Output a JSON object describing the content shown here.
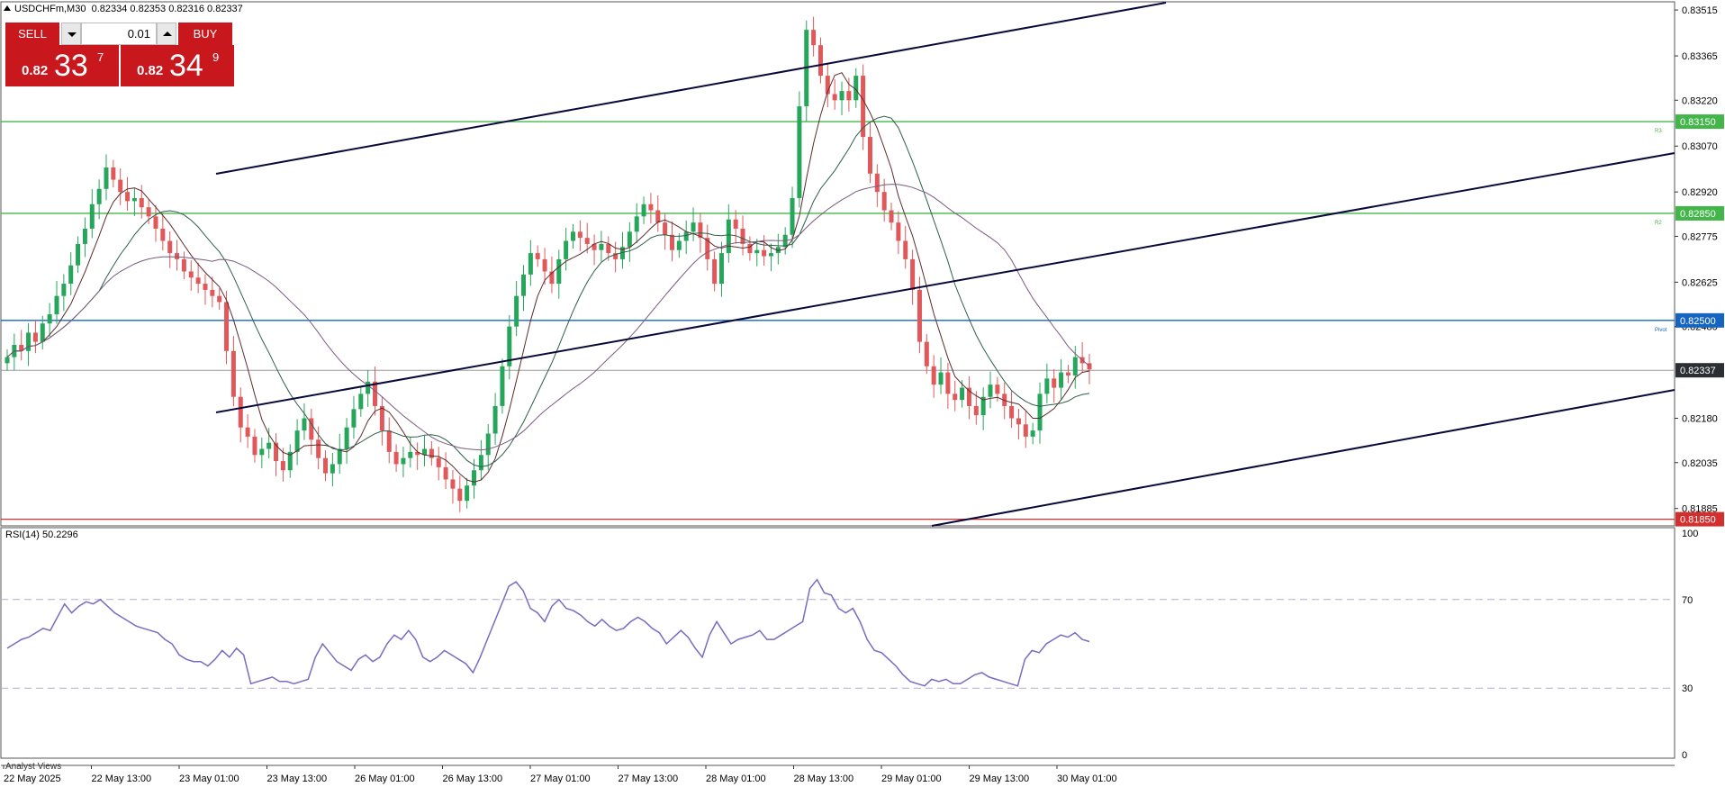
{
  "header": {
    "symbol": "USDCHFm,M30",
    "ohlc": "0.82334 0.82353 0.82316 0.82337"
  },
  "trade_panel": {
    "sell_label": "SELL",
    "buy_label": "BUY",
    "lot": "0.01",
    "sell_price_prefix": "0.82",
    "sell_price_big": "33",
    "sell_price_sup": "7",
    "buy_price_prefix": "0.82",
    "buy_price_big": "34",
    "buy_price_sup": "9"
  },
  "rsi": {
    "label": "RSI(14) 50.2296",
    "levels": [
      "100",
      "70",
      "30",
      "0"
    ]
  },
  "footer": {
    "analyst_label": "Analyst Views"
  },
  "colors": {
    "bull": "#26a65b",
    "bear": "#e0585a",
    "rsi_line": "#7b6ac2",
    "pivot": "#1565c0",
    "support": "#d32f2f",
    "resistance": "#43b649",
    "price_label_bg": "#2b2f33",
    "trendline": "#0a0a3a"
  },
  "chart_data": {
    "type": "candlestick",
    "price_axis_ticks": [
      "0.83515",
      "0.83365",
      "0.83220",
      "0.83070",
      "0.82920",
      "0.82775",
      "0.82625",
      "0.82480",
      "0.82180",
      "0.82035",
      "0.81885"
    ],
    "time_axis_ticks": [
      "22 May 2025",
      "22 May 13:00",
      "23 May 01:00",
      "23 May 13:00",
      "26 May 01:00",
      "26 May 13:00",
      "27 May 01:00",
      "27 May 13:00",
      "28 May 01:00",
      "28 May 13:00",
      "29 May 01:00",
      "29 May 13:00",
      "30 May 01:00"
    ],
    "price_range": [
      0.8184,
      0.8353
    ],
    "current_price": "0.82337",
    "levels": [
      {
        "label": "0.83150",
        "value": 0.8315,
        "color": "#43b649",
        "tag": "R3"
      },
      {
        "label": "0.82850",
        "value": 0.8285,
        "color": "#43b649",
        "tag": "R2"
      },
      {
        "label": "0.82500",
        "value": 0.825,
        "color": "#1565c0",
        "tag": "Pivot"
      },
      {
        "label": "0.81850",
        "value": 0.8185,
        "color": "#d32f2f",
        "tag": ""
      }
    ],
    "close_series": [
      0.8238,
      0.8242,
      0.824,
      0.8246,
      0.8243,
      0.8249,
      0.8252,
      0.8258,
      0.8262,
      0.8268,
      0.8275,
      0.828,
      0.8288,
      0.8293,
      0.83,
      0.8296,
      0.8292,
      0.8289,
      0.829,
      0.8287,
      0.8284,
      0.828,
      0.8276,
      0.8272,
      0.827,
      0.8266,
      0.8264,
      0.8262,
      0.826,
      0.8258,
      0.8256,
      0.824,
      0.8225,
      0.8215,
      0.8212,
      0.8206,
      0.8208,
      0.821,
      0.8204,
      0.8201,
      0.8207,
      0.8214,
      0.8218,
      0.8211,
      0.8205,
      0.82,
      0.8203,
      0.8208,
      0.8215,
      0.8221,
      0.8226,
      0.823,
      0.8222,
      0.8214,
      0.8207,
      0.8203,
      0.8205,
      0.8207,
      0.8206,
      0.8208,
      0.8205,
      0.8202,
      0.8198,
      0.8195,
      0.8191,
      0.8196,
      0.8201,
      0.8206,
      0.8213,
      0.8222,
      0.8235,
      0.8248,
      0.8258,
      0.8265,
      0.8272,
      0.827,
      0.8266,
      0.8262,
      0.827,
      0.8276,
      0.8279,
      0.8277,
      0.8275,
      0.8273,
      0.8275,
      0.8272,
      0.827,
      0.8274,
      0.8279,
      0.8284,
      0.8288,
      0.8286,
      0.8282,
      0.8278,
      0.8273,
      0.8276,
      0.8279,
      0.8282,
      0.8277,
      0.827,
      0.8262,
      0.8272,
      0.8283,
      0.828,
      0.8275,
      0.8272,
      0.8273,
      0.8271,
      0.8272,
      0.8274,
      0.8278,
      0.829,
      0.832,
      0.8345,
      0.834,
      0.833,
      0.8324,
      0.8322,
      0.8325,
      0.8322,
      0.833,
      0.831,
      0.8298,
      0.8292,
      0.8286,
      0.8282,
      0.8276,
      0.827,
      0.826,
      0.8243,
      0.8235,
      0.8229,
      0.8233,
      0.8226,
      0.8224,
      0.8228,
      0.8222,
      0.8219,
      0.8225,
      0.8229,
      0.8226,
      0.8222,
      0.8218,
      0.8216,
      0.8212,
      0.8214,
      0.8226,
      0.8231,
      0.8228,
      0.8233,
      0.8232,
      0.8238,
      0.8236,
      0.8234
    ],
    "rsi_values": [
      48,
      50,
      52,
      53,
      55,
      57,
      56,
      62,
      68,
      64,
      67,
      69,
      68,
      70,
      67,
      64,
      62,
      60,
      58,
      57,
      56,
      55,
      52,
      50,
      45,
      43,
      42,
      42,
      40,
      43,
      47,
      44,
      48,
      45,
      32,
      33,
      34,
      35,
      33,
      33,
      32,
      33,
      34,
      44,
      50,
      46,
      42,
      40,
      38,
      43,
      45,
      42,
      44,
      50,
      54,
      52,
      56,
      52,
      44,
      42,
      44,
      47,
      45,
      43,
      41,
      37,
      44,
      52,
      60,
      68,
      76,
      78,
      74,
      66,
      64,
      60,
      67,
      70,
      66,
      65,
      63,
      60,
      58,
      61,
      58,
      56,
      57,
      60,
      62,
      60,
      57,
      55,
      50,
      53,
      56,
      53,
      48,
      44,
      54,
      60,
      55,
      50,
      52,
      53,
      54,
      56,
      52,
      52,
      54,
      56,
      58,
      60,
      75,
      79,
      73,
      72,
      66,
      64,
      66,
      60,
      52,
      47,
      46,
      43,
      40,
      36,
      33,
      32,
      31,
      34,
      33,
      34,
      32,
      32,
      34,
      36,
      37,
      35,
      34,
      33,
      32,
      31,
      43,
      47,
      46,
      50,
      52,
      54,
      53,
      55,
      52,
      51
    ],
    "rsi_levels": [
      70,
      30
    ],
    "rsi_range": [
      0,
      100
    ]
  }
}
